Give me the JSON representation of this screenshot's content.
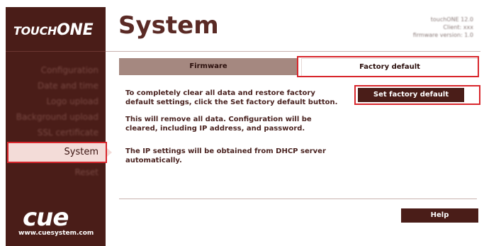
{
  "brand": {
    "touch": "TOUCH",
    "one": "ONE"
  },
  "sidebar": {
    "items": [
      {
        "label": "Configuration",
        "active": false
      },
      {
        "label": "Date and time",
        "active": false
      },
      {
        "label": "Logo upload",
        "active": false
      },
      {
        "label": "Background upload",
        "active": false
      },
      {
        "label": "SSL certificate",
        "active": false
      },
      {
        "label": "System",
        "active": true
      },
      {
        "label": "Reset",
        "active": false
      }
    ]
  },
  "logo": {
    "text": "cue",
    "url": "www.cuesystem.com"
  },
  "header": {
    "title": "System",
    "device_info": [
      "touchONE 12.0",
      "Client: xxx",
      "firmware version: 1.0"
    ]
  },
  "tabs": [
    {
      "label": "Firmware",
      "selected": false
    },
    {
      "label": "Factory default",
      "selected": true
    }
  ],
  "content": {
    "paragraph1": "To completely clear all data and restore factory default settings, click the Set factory default button.",
    "paragraph2": "This will remove all data. Configuration will be cleared, including IP address, and password.",
    "paragraph3": "The IP settings will be obtained from DHCP server automatically."
  },
  "buttons": {
    "set_factory_default": "Set factory default",
    "help": "Help"
  },
  "colors": {
    "sidebar": "#4a1d18",
    "accent_tab": "#a58880",
    "highlight": "#d8262c",
    "title": "#5a2a25"
  }
}
